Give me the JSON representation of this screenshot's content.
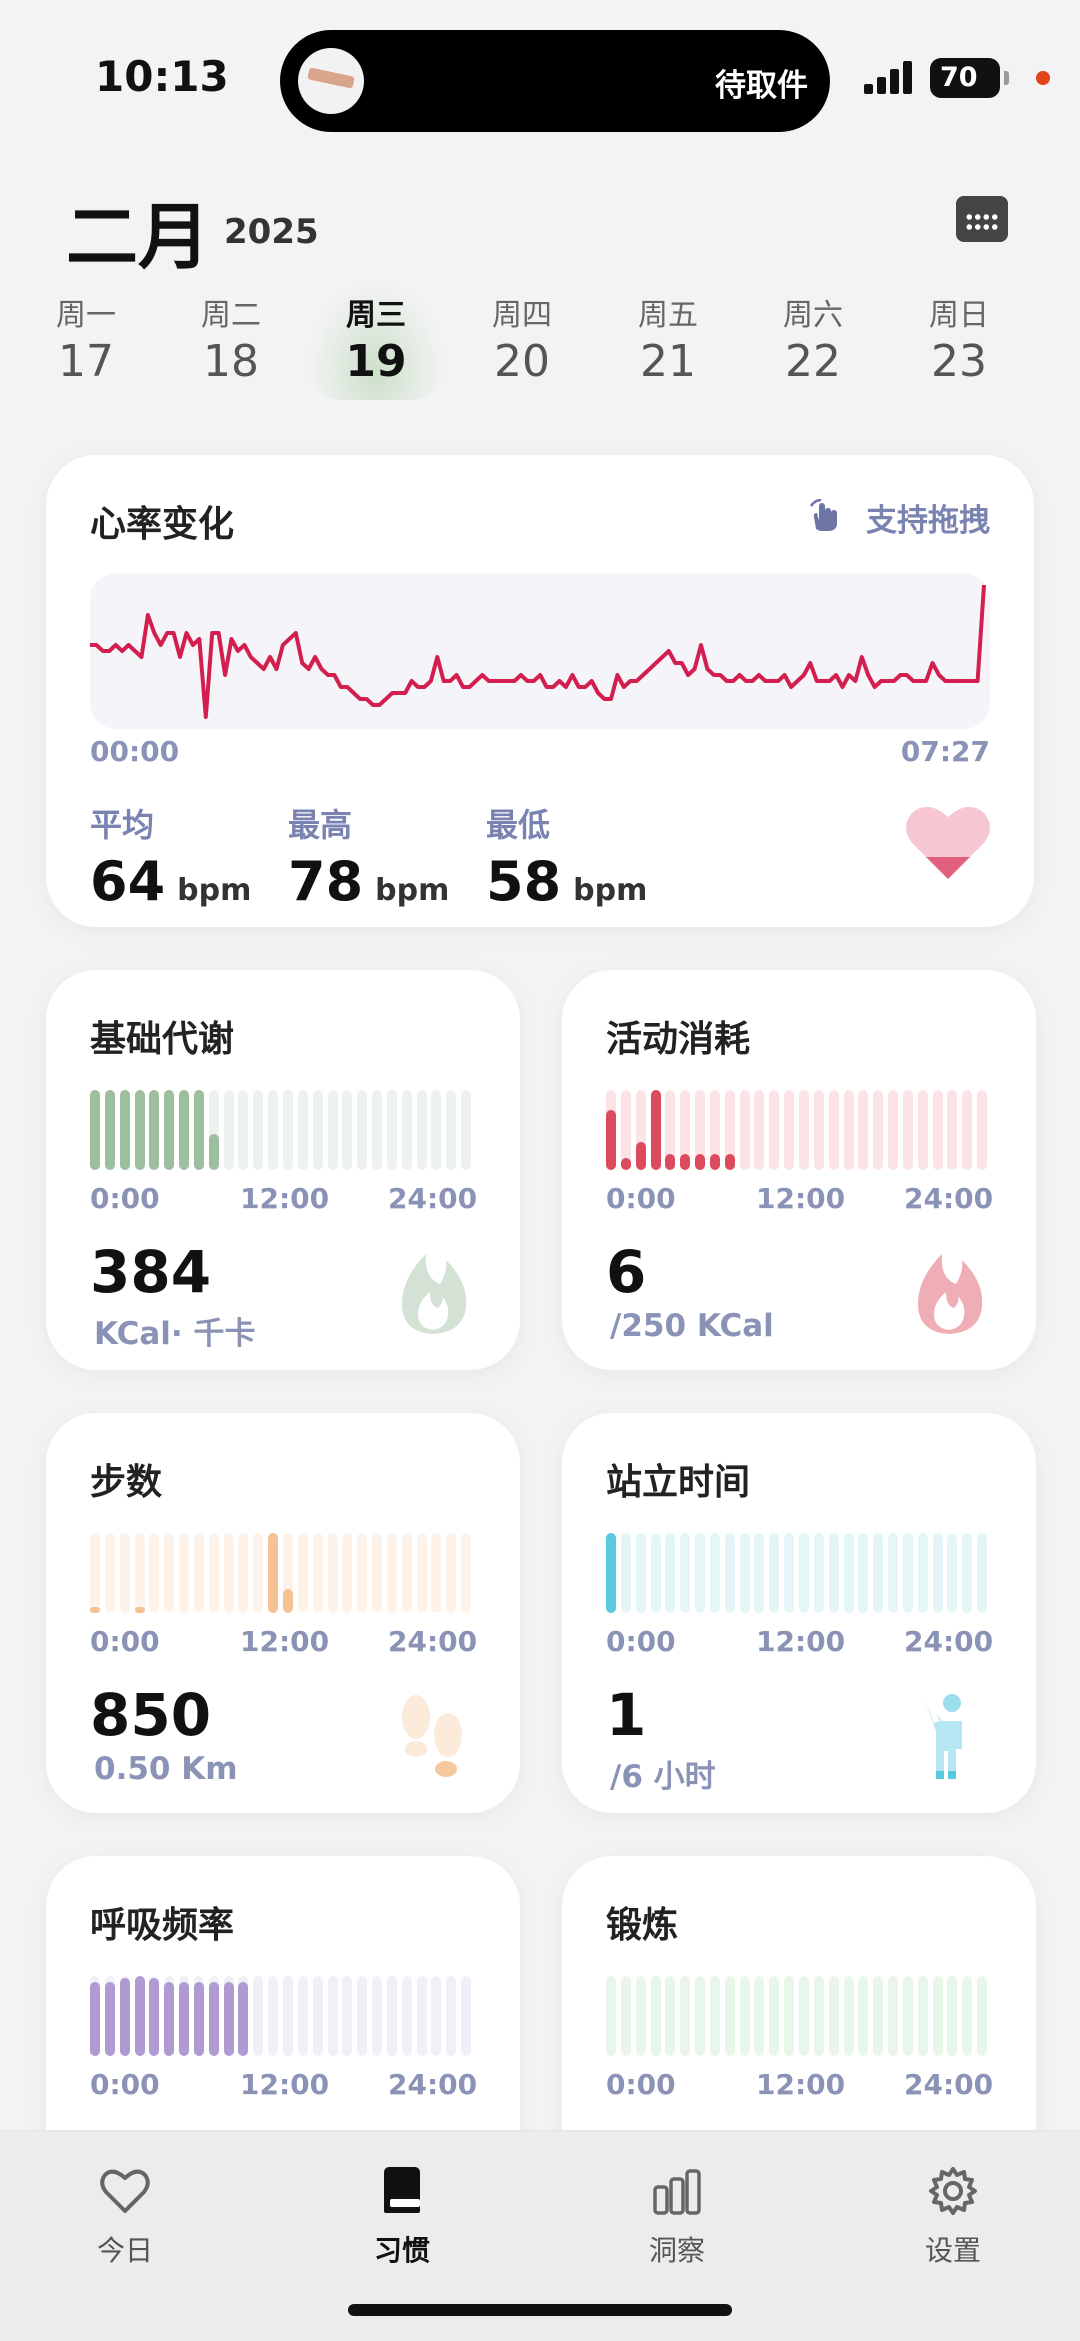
{
  "status_bar": {
    "time": "10:13",
    "live_activity": "待取件",
    "battery": "70",
    "icon": "signal-icon"
  },
  "header": {
    "month": "二月",
    "year": "2025",
    "calendar_icon": "calendar-icon"
  },
  "week": [
    {
      "label": "周一",
      "date": "17",
      "selected": false
    },
    {
      "label": "周二",
      "date": "18",
      "selected": false
    },
    {
      "label": "周三",
      "date": "19",
      "selected": true
    },
    {
      "label": "周四",
      "date": "20",
      "selected": false
    },
    {
      "label": "周五",
      "date": "21",
      "selected": false
    },
    {
      "label": "周六",
      "date": "22",
      "selected": false
    },
    {
      "label": "周日",
      "date": "23",
      "selected": false
    }
  ],
  "heart_rate": {
    "title": "心率变化",
    "drag_hint": "支持拖拽",
    "start_time": "00:00",
    "end_time": "07:27",
    "color": "#d31f4f",
    "avg_label": "平均",
    "avg_value": "64",
    "max_label": "最高",
    "max_value": "78",
    "min_label": "最低",
    "min_value": "58",
    "unit": "bpm",
    "icon": "heart-icon",
    "chart_data": {
      "type": "line",
      "y_unit": "bpm",
      "values": [
        68,
        68,
        67,
        67,
        68,
        67,
        68,
        67,
        66,
        73,
        70,
        68,
        70,
        70,
        66,
        70,
        68,
        69,
        56,
        70,
        70,
        63,
        69,
        67,
        68,
        66,
        65,
        64,
        66,
        64,
        68,
        69,
        70,
        65,
        64,
        66,
        64,
        63,
        63,
        61,
        61,
        60,
        59,
        59,
        58,
        58,
        59,
        60,
        60,
        60,
        62,
        61,
        61,
        62,
        66,
        62,
        62,
        63,
        61,
        61,
        62,
        63,
        62,
        62,
        62,
        62,
        62,
        63,
        62,
        62,
        63,
        61,
        61,
        62,
        61,
        63,
        61,
        61,
        62,
        60,
        59,
        59,
        63,
        61,
        62,
        62,
        63,
        64,
        65,
        66,
        67,
        65,
        65,
        63,
        64,
        68,
        64,
        63,
        63,
        62,
        62,
        63,
        62,
        62,
        63,
        62,
        62,
        62,
        63,
        61,
        62,
        63,
        65,
        62,
        62,
        62,
        63,
        61,
        63,
        62,
        66,
        63,
        61,
        62,
        62,
        62,
        63,
        63,
        62,
        62,
        62,
        65,
        63,
        62,
        62,
        62,
        62,
        62,
        62,
        78
      ]
    }
  },
  "cards": [
    {
      "key": "bmr",
      "title": "基础代谢",
      "value": "384",
      "unit": "KCal· 千卡",
      "color": "#9dbf9f",
      "faded": "#eef2ee",
      "icon": "flame-icon",
      "chart_data": {
        "type": "bar",
        "x_ticks": [
          "0:00",
          "12:00",
          "24:00"
        ],
        "values": [
          1,
          1,
          1,
          1,
          1,
          1,
          1,
          1,
          0.45,
          0,
          0,
          0,
          0,
          0,
          0,
          0,
          0,
          0,
          0,
          0,
          0,
          0,
          0,
          0,
          0,
          0
        ]
      }
    },
    {
      "key": "active",
      "title": "活动消耗",
      "value": "6",
      "unit": "/250 KCal",
      "color": "#dc4a5d",
      "faded": "#fbe3e6",
      "icon": "flame-icon",
      "chart_data": {
        "type": "bar",
        "x_ticks": [
          "0:00",
          "12:00",
          "24:00"
        ],
        "values": [
          0.75,
          0.15,
          0.35,
          1,
          0.2,
          0.2,
          0.2,
          0.2,
          0.2,
          0,
          0,
          0,
          0,
          0,
          0,
          0,
          0,
          0,
          0,
          0,
          0,
          0,
          0,
          0,
          0,
          0
        ]
      }
    },
    {
      "key": "steps",
      "title": "步数",
      "value": "850",
      "unit": "0.50 Km",
      "color": "#f5c294",
      "faded": "#fdf3ea",
      "icon": "footprints-icon",
      "chart_data": {
        "type": "bar",
        "x_ticks": [
          "0:00",
          "12:00",
          "24:00"
        ],
        "values": [
          0.03,
          0,
          0,
          0.03,
          0,
          0,
          0,
          0,
          0,
          0,
          0,
          0,
          1,
          0.3,
          0,
          0,
          0,
          0,
          0,
          0,
          0,
          0,
          0,
          0,
          0,
          0
        ]
      }
    },
    {
      "key": "standing",
      "title": "站立时间",
      "value": "1",
      "unit": "/6 小时",
      "color": "#5ac8e0",
      "faded": "#e5f6f9",
      "icon": "standing-person-icon",
      "chart_data": {
        "type": "bar",
        "x_ticks": [
          "0:00",
          "12:00",
          "24:00"
        ],
        "values": [
          1,
          0,
          0,
          0,
          0,
          0,
          0,
          0,
          0,
          0,
          0,
          0,
          0,
          0,
          0,
          0,
          0,
          0,
          0,
          0,
          0,
          0,
          0,
          0,
          0,
          0
        ]
      }
    },
    {
      "key": "breath",
      "title": "呼吸频率",
      "value": "",
      "unit": "",
      "color": "#b09ad2",
      "faded": "#f2eff7",
      "icon": "",
      "chart_data": {
        "type": "bar",
        "x_ticks": [
          "0:00",
          "12:00",
          "24:00"
        ],
        "values": [
          0.92,
          0.92,
          0.98,
          1,
          0.98,
          0.92,
          0.92,
          0.92,
          0.92,
          0.92,
          0.92,
          0,
          0,
          0,
          0,
          0,
          0,
          0,
          0,
          0,
          0,
          0,
          0,
          0,
          0,
          0
        ]
      }
    },
    {
      "key": "workout",
      "title": "锻炼",
      "value": "",
      "unit": "",
      "color": "#8fd29a",
      "faded": "#e9f6ea",
      "icon": "",
      "chart_data": {
        "type": "bar",
        "x_ticks": [
          "0:00",
          "12:00",
          "24:00"
        ],
        "values": [
          0,
          0,
          0,
          0,
          0,
          0,
          0,
          0,
          0,
          0,
          0,
          0,
          0,
          0,
          0,
          0,
          0,
          0,
          0,
          0,
          0,
          0,
          0,
          0,
          0,
          0
        ]
      }
    }
  ],
  "tabs": [
    {
      "label": "今日",
      "icon": "heart-outline-icon",
      "active": false
    },
    {
      "label": "习惯",
      "icon": "book-icon",
      "active": true
    },
    {
      "label": "洞察",
      "icon": "bar-chart-icon",
      "active": false
    },
    {
      "label": "设置",
      "icon": "gear-icon",
      "active": false
    }
  ]
}
